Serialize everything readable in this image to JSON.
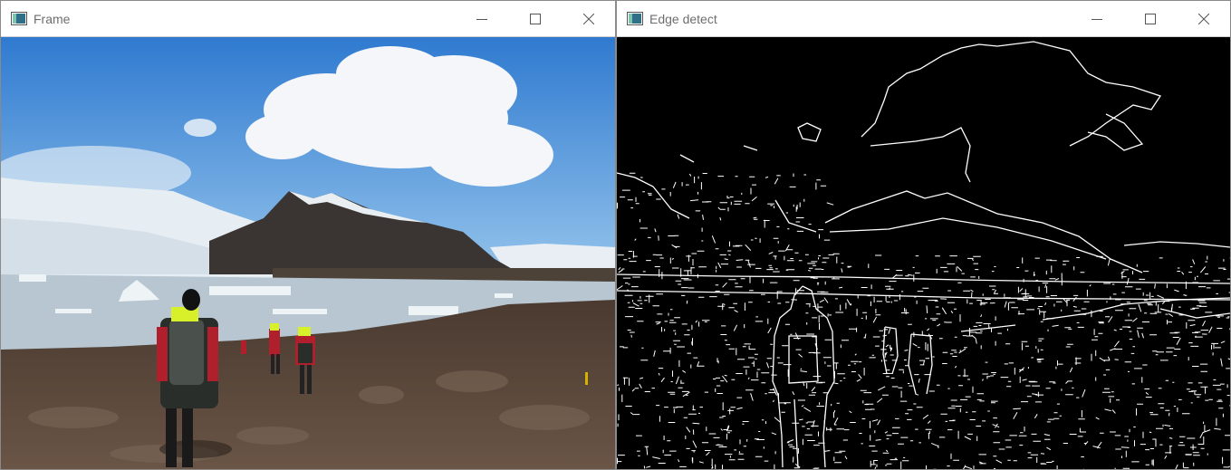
{
  "windows": [
    {
      "title": "Frame",
      "controls": [
        "minimize-icon",
        "maximize-icon",
        "close-icon"
      ],
      "content": "color video frame: glacier lagoon landscape with hikers"
    },
    {
      "title": "Edge detect",
      "controls": [
        "minimize-icon",
        "maximize-icon",
        "close-icon"
      ],
      "content": "edge-detected frame: white edges on black"
    }
  ],
  "colors": {
    "sky": "#3d86cf",
    "cloud": "#f2f4f7",
    "glacier": "#e4ecf2",
    "mountain": "#3a3633",
    "water": "#b9c8d3",
    "ground": "#5b4a3e",
    "jacket_red": "#b0202c",
    "vest_yellow": "#d8f02a",
    "edge_bg": "#000000",
    "edge_line": "#ffffff"
  }
}
